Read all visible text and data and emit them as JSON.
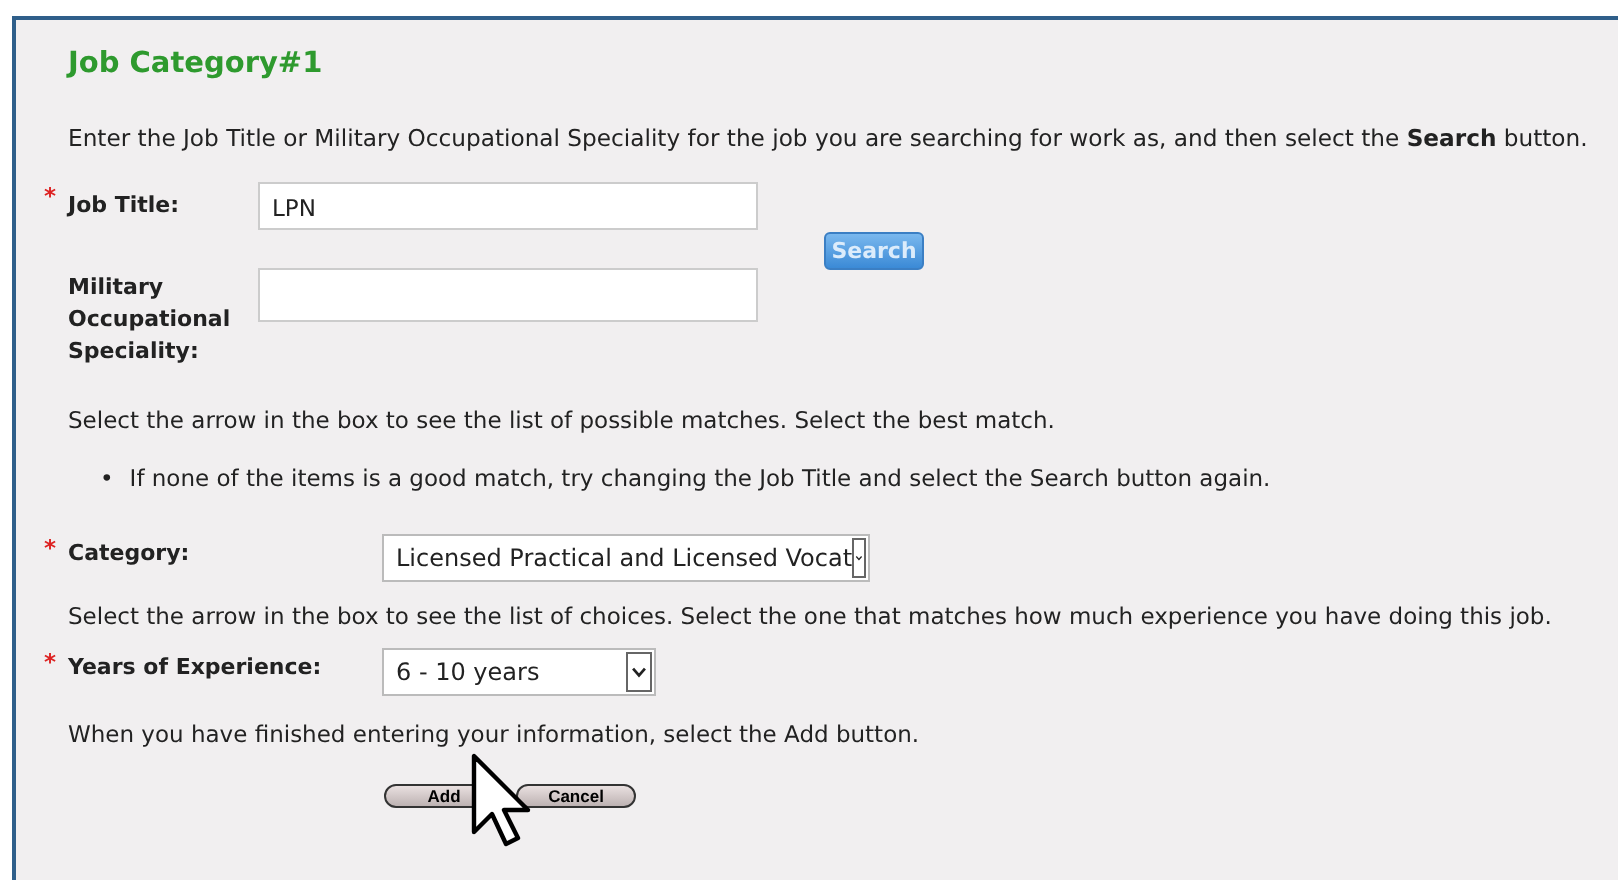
{
  "heading": "Job Category#1",
  "intro": "Enter the Job Title or Military Occupational Speciality for the job you are searching for work as, and then select the **Search** button.",
  "job_title": {
    "marker": "*",
    "label": "Job Title:",
    "value": "LPN"
  },
  "search_button": {
    "label": "Search",
    "disabled": true
  },
  "military": {
    "label_lines": [
      "Military",
      "Occupational",
      "Speciality:"
    ]
  },
  "match_hint": "Select the arrow in the box to see the list of possible matches. Select the best match.",
  "match_tips": [
    {
      "bullet": "•",
      "text": "If none of the items is a good match, try changing the Job Title and select the Search button again."
    }
  ],
  "category": {
    "marker": "*",
    "label": "Category:",
    "value": "Licensed Practical and Licensed Vocat"
  },
  "experience_hint": "Select the arrow in the box to see the list of choices. Select the one that matches how much experience you have doing this job.",
  "years": {
    "marker": "*",
    "label": "Years of Experience:",
    "value": "6 - 10 years"
  },
  "finish_hint": "When you have finished entering your information, select the Add button.",
  "buttons": [
    "Add",
    "Cancel"
  ]
}
